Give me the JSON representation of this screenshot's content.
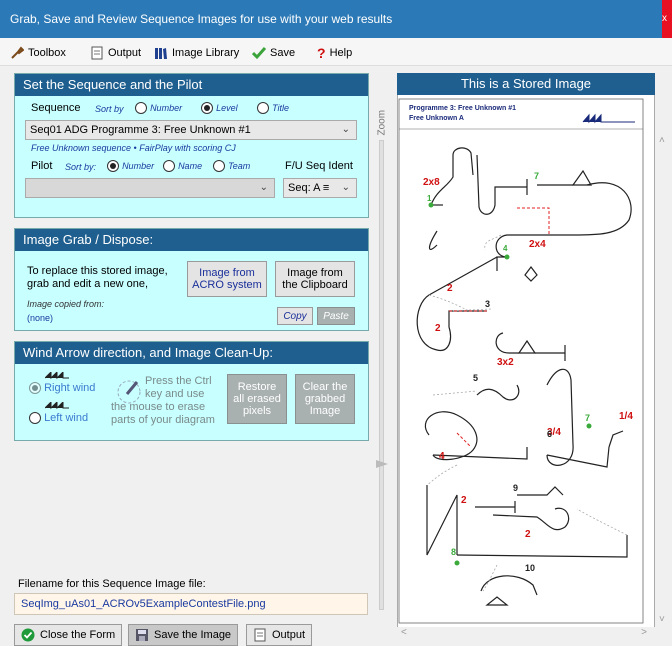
{
  "window": {
    "title": "Grab, Save and Review Sequence Images for use with your web results",
    "close": "x"
  },
  "toolbar": {
    "toolbox": "Toolbox",
    "output": "Output",
    "image_library": "Image Library",
    "save": "Save",
    "help": "Help"
  },
  "sequence_panel": {
    "title": "Set the Sequence and the Pilot",
    "sequence_label": "Sequence",
    "sort_by": "Sort by",
    "sort_options": [
      "Number",
      "Level",
      "Title"
    ],
    "sequence_value": "Seq01  ADG  Programme 3: Free Unknown #1",
    "info": "Free Unknown sequence  •  FairPlay with scoring CJ",
    "pilot_label": "Pilot",
    "pilot_sort_by": "Sort by:",
    "pilot_sort_options": [
      "Number",
      "Name",
      "Team"
    ],
    "fu_label": "F/U Seq Ident",
    "fu_value": "Seq: A ≡",
    "pilot_value": ""
  },
  "grab_panel": {
    "title": "Image Grab / Dispose:",
    "desc1": "To replace this stored image,",
    "desc2": "grab and edit a new one,",
    "acro_btn1": "Image from",
    "acro_btn2": "ACRO system",
    "clip_btn1": "Image from",
    "clip_btn2": "the Clipboard",
    "copied_from": "Image copied from:",
    "copied_value": "(none)",
    "copy": "Copy",
    "paste": "Paste"
  },
  "wind_panel": {
    "title": "Wind Arrow direction, and Image Clean-Up:",
    "right_wind": "Right wind",
    "left_wind": "Left wind",
    "hint1": "Press the Ctrl",
    "hint2": "key and use",
    "hint3": "the mouse to erase",
    "hint4": "parts of your diagram",
    "restore1": "Restore",
    "restore2": "all erased",
    "restore3": "pixels",
    "clear1": "Clear the",
    "clear2": "grabbed",
    "clear3": "Image"
  },
  "filename": {
    "label": "Filename for this Sequence Image file:",
    "value": "SeqImg_uAs01_ACROv5ExampleContestFile.png"
  },
  "bottom": {
    "close": "Close the Form",
    "save": "Save the Image",
    "output": "Output"
  },
  "zoom_label": "Zoom",
  "stored_image": {
    "title": "This is a Stored Image",
    "header1": "Programme 3: Free Unknown #1",
    "header2": "Free Unknown A",
    "labels": [
      "2x8",
      "1",
      "7",
      "2x4",
      "4",
      "2",
      "3",
      "2",
      "3x2",
      "5",
      "7",
      "1/4",
      "3/4",
      "4",
      "6",
      "9",
      "2",
      "2",
      "8",
      "10"
    ]
  }
}
